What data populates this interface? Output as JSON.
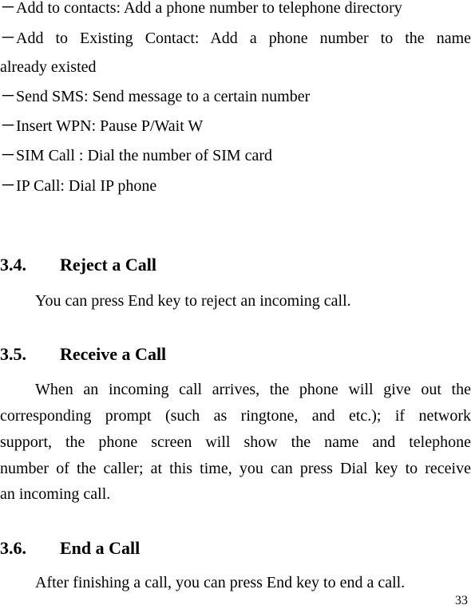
{
  "bullet_glyph": "－",
  "list_items": [
    {
      "text": "Add to contacts: Add a phone number to telephone directory"
    },
    {
      "text_line1": "Add  to  Existing  Contact:  Add  a  phone  number  to  the  name",
      "text_line2": "already existed"
    },
    {
      "text": "Send SMS: Send message to a certain number"
    },
    {
      "text": "Insert WPN: Pause P/Wait W"
    },
    {
      "text": "SIM Call : Dial the number of SIM card"
    },
    {
      "text": "IP Call: Dial IP phone"
    }
  ],
  "sections": [
    {
      "number": "3.4.",
      "title": "Reject a Call",
      "paragraph_lines": [
        "You can press End key to reject an incoming call."
      ]
    },
    {
      "number": "3.5.",
      "title": "Receive a Call",
      "paragraph_lines": [
        "When an incoming call arrives, the phone will give out the",
        "corresponding prompt (such as ringtone, and etc.); if network",
        "support, the phone screen will show the name and telephone",
        "number of the caller; at this time, you can press Dial key to receive",
        "an incoming call."
      ]
    },
    {
      "number": "3.6.",
      "title": "End a Call",
      "paragraph_lines": [
        "After finishing a call, you can press End key to end a call."
      ]
    }
  ],
  "page_number": "33"
}
